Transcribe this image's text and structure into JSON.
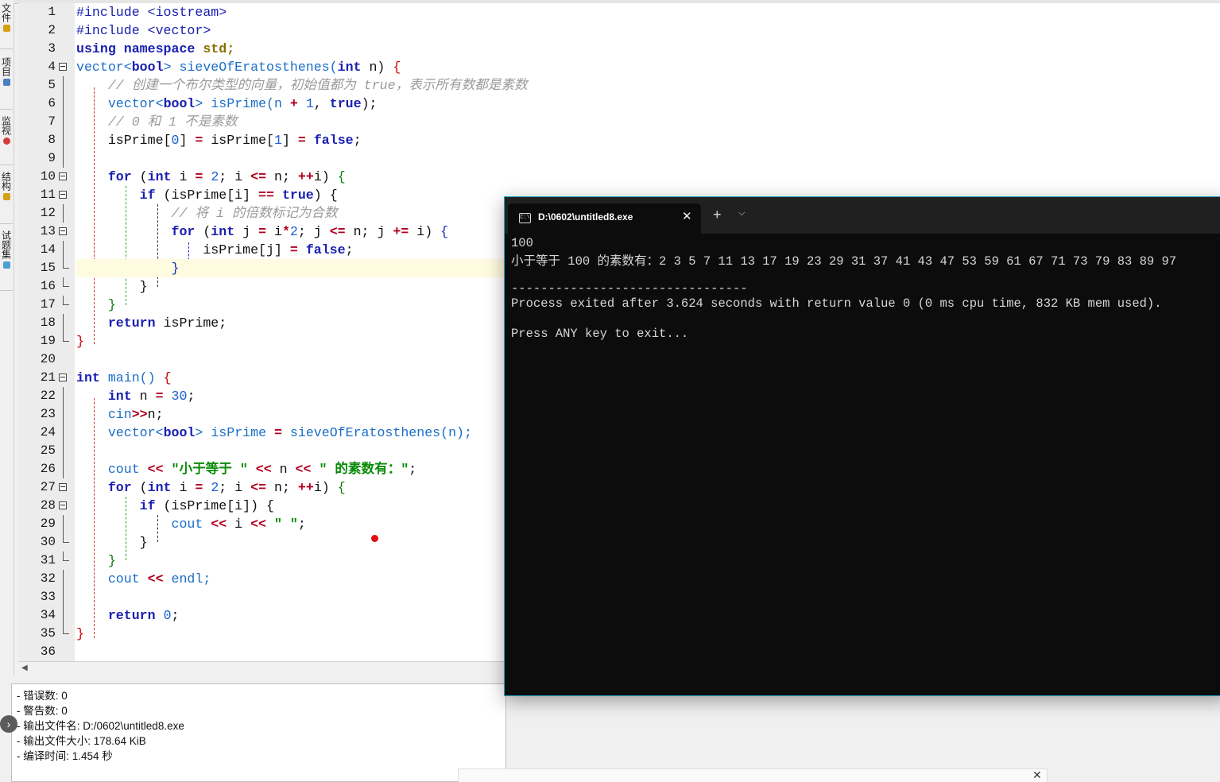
{
  "side_tabs": [
    {
      "label": "文件",
      "icon": "folder-icon",
      "color": "#d4a017"
    },
    {
      "label": "项目",
      "icon": "project-icon",
      "color": "#4a7fc1"
    },
    {
      "label": "监视",
      "icon": "watch-icon",
      "color": "#d23c3c"
    },
    {
      "label": "结构",
      "icon": "structure-icon",
      "color": "#d4a017"
    },
    {
      "label": "试题集",
      "icon": "problem-set-icon",
      "color": "#4aa0d0"
    }
  ],
  "line_numbers": [
    "1",
    "2",
    "3",
    "4",
    "5",
    "6",
    "7",
    "8",
    "9",
    "10",
    "11",
    "12",
    "13",
    "14",
    "15",
    "16",
    "17",
    "18",
    "19",
    "20",
    "21",
    "22",
    "23",
    "24",
    "25",
    "26",
    "27",
    "28",
    "29",
    "30",
    "31",
    "32",
    "33",
    "34",
    "35",
    "36"
  ],
  "code": {
    "l1": "#include <iostream>",
    "l2": "#include <vector>",
    "l3a": "using namespace",
    "l3b": " std;",
    "l4a": "vector<",
    "l4b": "bool",
    "l4c": "> sieveOfEratosthenes(",
    "l4d": "int",
    "l4e": " n) ",
    "l4f": "{",
    "l5": "// 创建一个布尔类型的向量，初始值都为 true，表示所有数都是素数",
    "l6a": "vector<",
    "l6b": "bool",
    "l6c": "> isPrime(n ",
    "l6d": "+",
    "l6e": " ",
    "l6f": "1",
    "l6g": ", ",
    "l6h": "true",
    "l6i": ");",
    "l7": "// 0 和 1 不是素数",
    "l8a": "isPrime[",
    "l8b": "0",
    "l8c": "] ",
    "l8d": "=",
    "l8e": " isPrime[",
    "l8f": "1",
    "l8g": "] ",
    "l8h": "=",
    "l8i": " ",
    "l8j": "false",
    "l8k": ";",
    "l10a": "for",
    "l10b": " (",
    "l10c": "int",
    "l10d": " i ",
    "l10e": "=",
    "l10f": " ",
    "l10g": "2",
    "l10h": "; i ",
    "l10i": "<=",
    "l10j": " n; ",
    "l10k": "++",
    "l10l": "i) ",
    "l10m": "{",
    "l11a": "if",
    "l11b": " (isPrime[i] ",
    "l11c": "==",
    "l11d": " ",
    "l11e": "true",
    "l11f": ") {",
    "l12": "// 将 i 的倍数标记为合数",
    "l13a": "for",
    "l13b": " (",
    "l13c": "int",
    "l13d": " j ",
    "l13e": "=",
    "l13f": " i",
    "l13g": "*",
    "l13h": "2",
    "l13i": "; j ",
    "l13j": "<=",
    "l13k": " n; j ",
    "l13l": "+=",
    "l13m": " i) ",
    "l13n": "{",
    "l14a": "isPrime[j] ",
    "l14b": "=",
    "l14c": " ",
    "l14d": "false",
    "l14e": ";",
    "l15": "}",
    "l16": "}",
    "l17": "}",
    "l18a": "return",
    "l18b": " isPrime;",
    "l19": "}",
    "l21a": "int",
    "l21b": " main() ",
    "l21c": "{",
    "l22a": "int",
    "l22b": " n ",
    "l22c": "=",
    "l22d": " ",
    "l22e": "30",
    "l22f": ";",
    "l23a": "cin",
    "l23b": ">>",
    "l23c": "n;",
    "l24a": "vector<",
    "l24b": "bool",
    "l24c": "> isPrime ",
    "l24d": "=",
    "l24e": " sieveOfEratosthenes(n);",
    "l26a": "cout ",
    "l26b": "<<",
    "l26c": " ",
    "l26d": "\"小于等于 \"",
    "l26e": " ",
    "l26f": "<<",
    "l26g": " n ",
    "l26h": "<<",
    "l26i": " ",
    "l26j": "\" 的素数有：\"",
    "l26k": ";",
    "l27a": "for",
    "l27b": " (",
    "l27c": "int",
    "l27d": " i ",
    "l27e": "=",
    "l27f": " ",
    "l27g": "2",
    "l27h": "; i ",
    "l27i": "<=",
    "l27j": " n; ",
    "l27k": "++",
    "l27l": "i) ",
    "l27m": "{",
    "l28a": "if",
    "l28b": " (isPrime[i]) {",
    "l29a": "cout ",
    "l29b": "<<",
    "l29c": " i ",
    "l29d": "<<",
    "l29e": " ",
    "l29f": "\" \"",
    "l29g": ";",
    "l30": "}",
    "l31": "}",
    "l32a": "cout ",
    "l32b": "<<",
    "l32c": " endl;",
    "l34a": "return",
    "l34b": " ",
    "l34c": "0",
    "l34d": ";",
    "l35": "}"
  },
  "compile_log": [
    "- 错误数: 0",
    "- 警告数: 0",
    "- 输出文件名: D:/0602\\untitled8.exe",
    "- 输出文件大小: 178.64 KiB",
    "- 编译时间: 1.454 秒"
  ],
  "terminal": {
    "title": "D:\\0602\\untitled8.exe",
    "tab_icon": "console-icon",
    "new_tab": "+",
    "lines": [
      "100",
      "小于等于 100 的素数有：2 3 5 7 11 13 17 19 23 29 31 37 41 43 47 53 59 61 67 71 73 79 83 89 97",
      "",
      "--------------------------------",
      "Process exited after 3.624 seconds with return value 0 (0 ms cpu time, 832 KB mem used).",
      "",
      "Press ANY key to exit..."
    ]
  },
  "colors": {
    "terminal_border": "#28a3c7",
    "terminal_bg": "#0c0c0c",
    "breakpoint": "#e01010",
    "keyword": "#1a20b0",
    "string": "#0a8a0a"
  }
}
